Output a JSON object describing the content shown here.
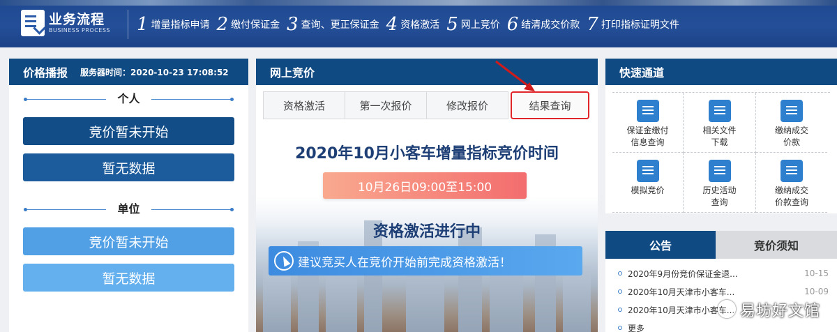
{
  "header": {
    "brand_cn": "业务流程",
    "brand_en": "BUSINESS PROCESS",
    "steps": [
      {
        "num": "1",
        "label": "增量指标申请"
      },
      {
        "num": "2",
        "label": "缴付保证金"
      },
      {
        "num": "3",
        "label": "查询、更正保证金"
      },
      {
        "num": "4",
        "label": "资格激活"
      },
      {
        "num": "5",
        "label": "网上竞价"
      },
      {
        "num": "6",
        "label": "结清成交价款"
      },
      {
        "num": "7",
        "label": "打印指标证明文件"
      }
    ]
  },
  "left": {
    "title": "价格播报",
    "server_time": "服务器时间：2020-10-23 17:08:52",
    "personal": {
      "title": "个人",
      "btn1": "竞价暂未开始",
      "btn2": "暂无数据"
    },
    "unit": {
      "title": "单位",
      "btn1": "竞价暂未开始",
      "btn2": "暂无数据"
    }
  },
  "middle": {
    "title": "网上竞价",
    "tabs": [
      "资格激活",
      "第一次报价",
      "修改报价",
      "结果查询"
    ],
    "headline": "2020年10月小客车增量指标竞价时间",
    "time": "10月26日09:00至15:00",
    "status": "资格激活进行中",
    "notice": "建议竞买人在竞价开始前完成资格激活！"
  },
  "right": {
    "quick_title": "快速通道",
    "quick_items": [
      {
        "label": "保证金缴付\n信息查询",
        "icon": "card-icon"
      },
      {
        "label": "相关文件\n下载",
        "icon": "download-icon"
      },
      {
        "label": "缴纳成交\n价款",
        "icon": "payment-icon"
      },
      {
        "label": "模拟竞价",
        "icon": "gavel-icon"
      },
      {
        "label": "历史活动\n查询",
        "icon": "document-icon"
      },
      {
        "label": "缴纳成交\n价款查询",
        "icon": "payment-search-icon"
      }
    ],
    "ann_tab_active": "公告",
    "ann_tab_other": "竞价须知",
    "announcements": [
      {
        "title": "2020年9月份竞价保证金退...",
        "date": "10-15"
      },
      {
        "title": "2020年10月天津市小客车...",
        "date": "10-09"
      },
      {
        "title": "2020年10月天津市小客车...",
        "date": ""
      },
      {
        "title": "更多",
        "date": ""
      }
    ]
  },
  "watermark": "易坊好文馆",
  "colors": {
    "primary": "#104a83",
    "accent_red": "#e0262a",
    "light_blue": "#51a0e6"
  }
}
